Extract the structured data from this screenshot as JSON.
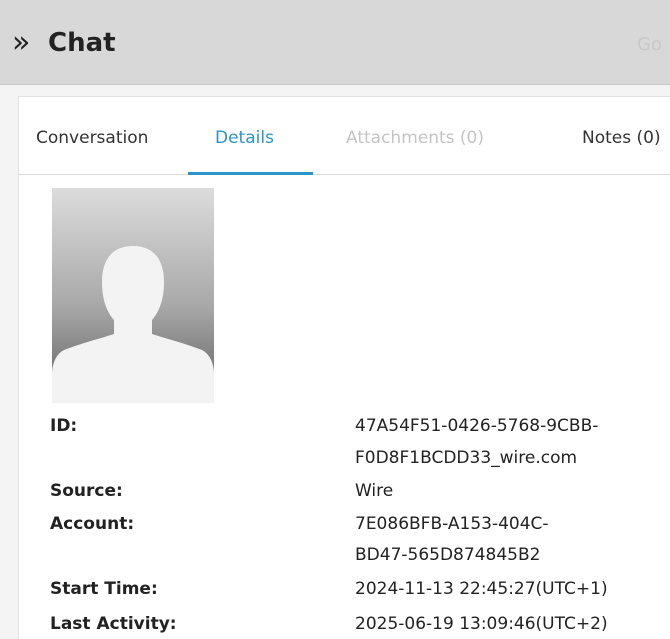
{
  "header": {
    "expand_icon": "double-chevron-right",
    "title": "Chat",
    "go_label": "Go"
  },
  "tabs": [
    {
      "label": "Conversation"
    },
    {
      "label": "Details",
      "active": true
    },
    {
      "label": "Attachments (0)",
      "disabled": true
    },
    {
      "label": "Notes (0)"
    }
  ],
  "colors": {
    "accent": "#2b95c9",
    "header_bg": "#d8d8d8"
  },
  "avatar": {
    "icon": "default-user-avatar"
  },
  "details": {
    "id_label": "ID:",
    "id_value_line1": "47A54F51-0426-5768-9CBB-",
    "id_value_line2": "F0D8F1BCDD33_wire.com",
    "source_label": "Source:",
    "source_value": "Wire",
    "account_label": "Account:",
    "account_value_line1": "7E086BFB-A153-404C-",
    "account_value_line2": "BD47-565D874845B2",
    "start_time_label": "Start Time:",
    "start_time_value": "2024-11-13 22:45:27(UTC+1)",
    "last_activity_label": "Last Activity:",
    "last_activity_value": "2025-06-19 13:09:46(UTC+2)"
  }
}
